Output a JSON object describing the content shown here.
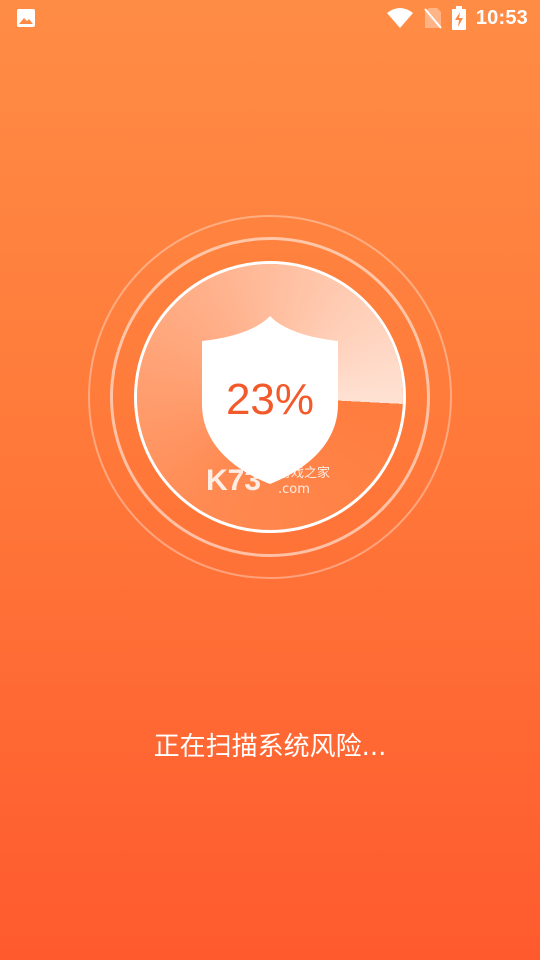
{
  "status_bar": {
    "time": "10:53",
    "icons": [
      "image-icon",
      "wifi-icon",
      "no-sim-icon",
      "battery-charging-icon"
    ]
  },
  "scanner": {
    "progress_percent": 23,
    "progress_label": "23%",
    "watermark_brand": "K73",
    "watermark_site": "游戏之家",
    "watermark_domain": ".com"
  },
  "scan_status": "正在扫描系统风险...",
  "colors": {
    "background_top": "#ff8c45",
    "background_bottom": "#ff5a2e",
    "percent_text": "#f35a2b"
  }
}
